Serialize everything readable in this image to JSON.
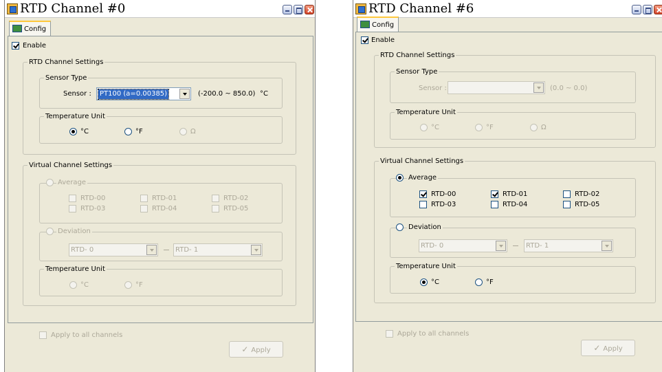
{
  "windows": [
    {
      "title": "RTD Channel #0",
      "tab": "Config",
      "enable_label": "Enable",
      "rtd_settings": {
        "legend": "RTD Channel Settings",
        "sensor_type_legend": "Sensor Type",
        "sensor_label": "Sensor :",
        "sensor_value": "PT100 (a=0.00385)",
        "range": "(-200.0 ~ 850.0)",
        "range_unit": "°C",
        "temp_unit_legend": "Temperature Unit",
        "units": [
          "°C",
          "°F",
          "Ω"
        ]
      },
      "virtual_settings": {
        "legend": "Virtual Channel Settings",
        "average_label": "Average",
        "channels": [
          "RTD-00",
          "RTD-01",
          "RTD-02",
          "RTD-03",
          "RTD-04",
          "RTD-05"
        ],
        "deviation_label": "Deviation",
        "deviation_from": "RTD- 0",
        "deviation_to": "RTD- 1",
        "temp_unit_legend": "Temperature Unit",
        "units": [
          "°C",
          "°F"
        ]
      },
      "apply_all_label": "Apply to all channels",
      "apply_button": "Apply"
    },
    {
      "title": "RTD Channel #6",
      "tab": "Config",
      "enable_label": "Enable",
      "rtd_settings": {
        "legend": "RTD Channel Settings",
        "sensor_type_legend": "Sensor Type",
        "sensor_label": "Sensor :",
        "sensor_value": "",
        "range": "(0.0 ~ 0.0)",
        "range_unit": "",
        "temp_unit_legend": "Temperature Unit",
        "units": [
          "°C",
          "°F",
          "Ω"
        ]
      },
      "virtual_settings": {
        "legend": "Virtual Channel Settings",
        "average_label": "Average",
        "channels": [
          "RTD-00",
          "RTD-01",
          "RTD-02",
          "RTD-03",
          "RTD-04",
          "RTD-05"
        ],
        "deviation_label": "Deviation",
        "deviation_from": "RTD- 0",
        "deviation_to": "RTD- 1",
        "temp_unit_legend": "Temperature Unit",
        "units": [
          "°C",
          "°F"
        ]
      },
      "apply_all_label": "Apply to all channels",
      "apply_button": "Apply"
    }
  ]
}
